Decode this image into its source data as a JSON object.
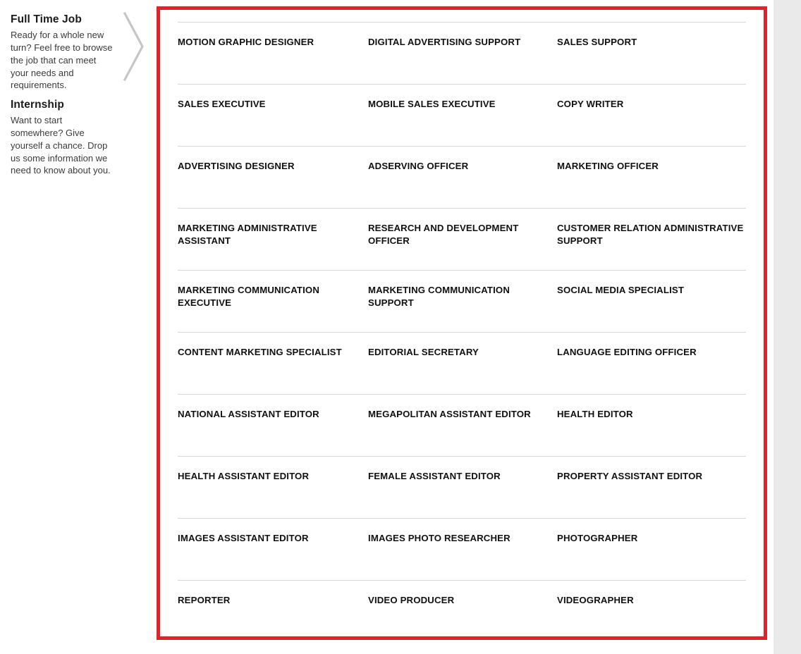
{
  "sidebar": {
    "sections": [
      {
        "heading": "Full Time Job",
        "body": "Ready for a whole new turn? Feel free to browse the job that can meet your needs and requirements."
      },
      {
        "heading": "Internship",
        "body": "Want to start somewhere? Give yourself a chance. Drop us some information we need to know about you."
      }
    ]
  },
  "decoration": {
    "chevron_icon": "chevron-right-icon",
    "chevron_color": "#c6c6c6"
  },
  "colors": {
    "frame_red": "#e0222a",
    "separator_gray": "#d6d6d6",
    "gutter_gray": "#eaeaea",
    "title_black": "#111111",
    "body_gray": "#3b3b3b"
  },
  "job_grid": {
    "columns": 3,
    "rows": [
      [
        "MOTION GRAPHIC DESIGNER",
        "DIGITAL ADVERTISING SUPPORT",
        "SALES SUPPORT"
      ],
      [
        "SALES EXECUTIVE",
        "MOBILE SALES EXECUTIVE",
        "COPY WRITER"
      ],
      [
        "ADVERTISING DESIGNER",
        "ADSERVING OFFICER",
        "MARKETING OFFICER"
      ],
      [
        "MARKETING ADMINISTRATIVE ASSISTANT",
        "RESEARCH AND DEVELOPMENT OFFICER",
        "CUSTOMER RELATION ADMINISTRATIVE SUPPORT"
      ],
      [
        "MARKETING COMMUNICATION EXECUTIVE",
        "MARKETING COMMUNICATION SUPPORT",
        "SOCIAL MEDIA SPECIALIST"
      ],
      [
        "CONTENT MARKETING SPECIALIST",
        "EDITORIAL SECRETARY",
        "LANGUAGE EDITING OFFICER"
      ],
      [
        "NATIONAL ASSISTANT EDITOR",
        "MEGAPOLITAN ASSISTANT EDITOR",
        "HEALTH EDITOR"
      ],
      [
        "HEALTH ASSISTANT EDITOR",
        "FEMALE ASSISTANT EDITOR",
        "PROPERTY ASSISTANT EDITOR"
      ],
      [
        "IMAGES ASSISTANT EDITOR",
        "IMAGES PHOTO RESEARCHER",
        "PHOTOGRAPHER"
      ],
      [
        "REPORTER",
        "VIDEO PRODUCER",
        "VIDEOGRAPHER"
      ]
    ]
  }
}
